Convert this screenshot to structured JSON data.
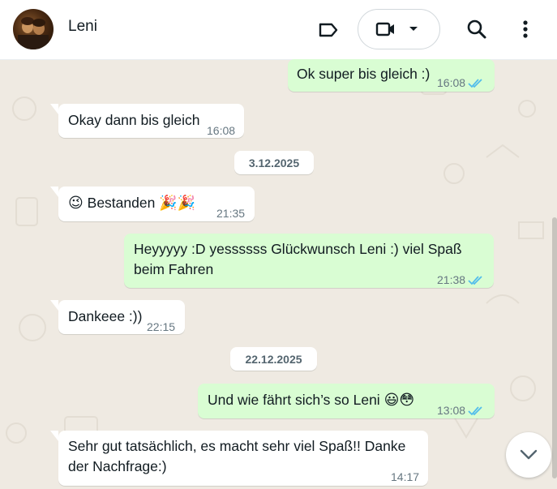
{
  "contact": {
    "name": "Leni"
  },
  "colors": {
    "incoming": "#ffffff",
    "outgoing": "#d9fdd3",
    "read_ticks": "#53bdeb",
    "background": "#efeae2"
  },
  "header_icons": [
    "label-icon",
    "video-call-icon",
    "chevron-down-icon",
    "search-icon",
    "more-options-icon"
  ],
  "messages": [
    {
      "dir": "out",
      "text": "Ok super bis gleich :)",
      "time": "16:08",
      "read": true
    },
    {
      "dir": "in",
      "text": "Okay dann bis gleich",
      "time": "16:08"
    },
    {
      "date": "3.12.2025"
    },
    {
      "dir": "in",
      "emoji_start": "😉",
      "text": "Bestanden",
      "emoji_end": "🎉🎉",
      "time": "21:35"
    },
    {
      "dir": "out",
      "text": "Heyyyyy :D yessssss Glückwunsch Leni :) viel Spaß beim Fahren",
      "line1": "Heyyyyy :D yessssss Glückwunsch Leni :) viel Spaß",
      "line2": "beim Fahren",
      "time": "21:38",
      "read": true
    },
    {
      "dir": "in",
      "text": "Dankeee :))",
      "time": "22:15"
    },
    {
      "date": "22.12.2025"
    },
    {
      "dir": "out",
      "text": "Und wie fährt sich’s so Leni",
      "emoji_end": "😃😳",
      "time": "13:08",
      "read": true
    },
    {
      "dir": "in",
      "text": "Sehr gut tatsächlich, es macht sehr viel Spaß!! Danke der Nachfrage:)",
      "line1": "Sehr gut tatsächlich, es macht sehr viel Spaß!! Danke",
      "line2": "der Nachfrage:)",
      "time": "14:17"
    }
  ]
}
